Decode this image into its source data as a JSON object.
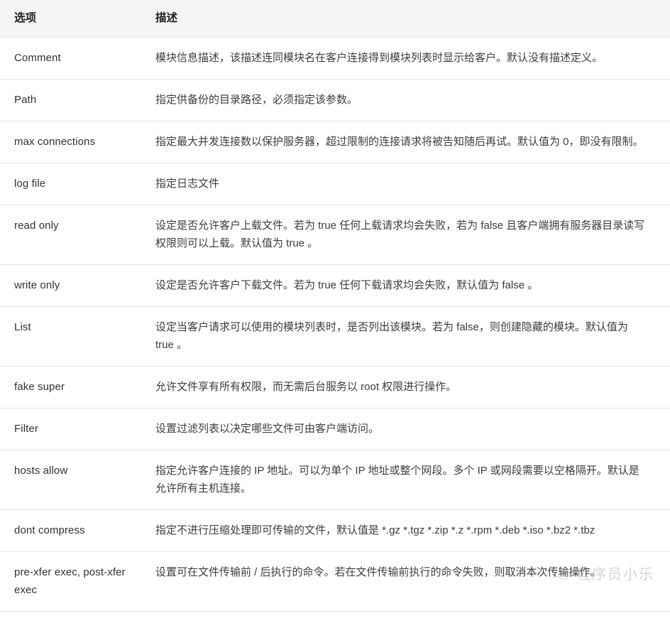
{
  "table": {
    "columns": [
      {
        "key": "option",
        "label": "选项"
      },
      {
        "key": "description",
        "label": "描述"
      }
    ],
    "rows": [
      {
        "option": "Comment",
        "description": "模块信息描述，该描述连同模块名在客户连接得到模块列表时显示给客户。默认没有描述定义。"
      },
      {
        "option": "Path",
        "description": "指定供备份的目录路径，必须指定该参数。"
      },
      {
        "option": "max connections",
        "description": "指定最大并发连接数以保护服务器，超过限制的连接请求将被告知随后再试。默认值为 0，即没有限制。"
      },
      {
        "option": "log file",
        "description": "指定日志文件"
      },
      {
        "option": "read only",
        "description": "设定是否允许客户上载文件。若为 true 任何上载请求均会失败，若为 false 且客户端拥有服务器目录读写权限则可以上载。默认值为 true 。"
      },
      {
        "option": "write only",
        "description": "设定是否允许客户下载文件。若为 true 任何下载请求均会失败，默认值为 false 。"
      },
      {
        "option": "List",
        "description": "设定当客户请求可以使用的模块列表时，是否列出该模块。若为 false，则创建隐藏的模块。默认值为 true 。"
      },
      {
        "option": "fake super",
        "description": "允许文件享有所有权限，而无需后台服务以 root 权限进行操作。"
      },
      {
        "option": "Filter",
        "description": "设置过滤列表以决定哪些文件可由客户端访问。"
      },
      {
        "option": "hosts allow",
        "description": "指定允许客户连接的 IP 地址。可以为单个 IP 地址或整个网段。多个 IP 或网段需要以空格隔开。默认是允许所有主机连接。"
      },
      {
        "option": "dont compress",
        "description": "指定不进行压缩处理即可传输的文件，默认值是 *.gz *.tgz *.zip *.z *.rpm *.deb *.iso *.bz2 *.tbz"
      },
      {
        "option": "pre-xfer exec, post-xfer exec",
        "description": "设置可在文件传输前 / 后执行的命令。若在文件传输前执行的命令失败，则取消本次传输操作。"
      }
    ]
  },
  "watermark": {
    "text": "程序员小乐",
    "logo_icon": "wechat-bubble-icon"
  },
  "colors": {
    "header_background": "#f4f4f4",
    "row_border": "#e6e6e6",
    "text": "#3d3d3d",
    "heading_text": "#1f1f1f",
    "page_background": "#ffffff"
  }
}
